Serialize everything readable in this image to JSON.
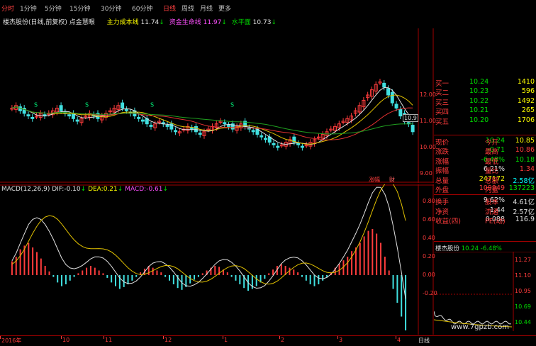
{
  "toolbar": {
    "tabs": [
      "分时",
      "1分钟",
      "5分钟",
      "15分钟",
      "30分钟",
      "60分钟",
      "日线",
      "周线",
      "月线",
      "更多"
    ],
    "active_tab": "日线"
  },
  "chart_header": {
    "stock_desc": "楼杰股份(日线,前复权) 点金慧眼",
    "ind1_label": "主力成本线",
    "ind1_value": "11.74",
    "ind2_label": "资金生命线",
    "ind2_value": "11.97",
    "ind3_label": "水平面",
    "ind3_value": "10.73"
  },
  "price_axis": [
    "12.00",
    "11.00",
    "10.00",
    "9.00"
  ],
  "price_tag": "10.9",
  "markers": {
    "m1": "涨幅",
    "m2": "财"
  },
  "macd_header": {
    "label": "MACD(12,26,9)",
    "dif_label": "DIF:",
    "dif_value": "-0.10",
    "dea_label": "DEA:",
    "dea_value": "0.21",
    "macd_label": "MACD:",
    "macd_value": "-0.61"
  },
  "macd_axis": [
    "0.80",
    "0.60",
    "0.40",
    "0.20",
    "0.00",
    "-0.20"
  ],
  "quote": {
    "bids": [
      {
        "label": "买一",
        "price": "10.24",
        "vol": "1410"
      },
      {
        "label": "买二",
        "price": "10.23",
        "vol": "596"
      },
      {
        "label": "买三",
        "price": "10.22",
        "vol": "1492"
      },
      {
        "label": "买四",
        "price": "10.21",
        "vol": "265"
      },
      {
        "label": "买五",
        "price": "10.20",
        "vol": "1706"
      }
    ],
    "stats": [
      {
        "l1": "现价",
        "v1": "10.24",
        "l2": "今开",
        "v2": "10.85"
      },
      {
        "l1": "涨跌",
        "v1": "-0.71",
        "l2": "最高",
        "v2": "10.86"
      },
      {
        "l1": "涨幅",
        "v1": "-6.48%",
        "l2": "最低",
        "v2": "10.18"
      },
      {
        "l1": "振幅",
        "v1": "6.21%",
        "l2": "量比",
        "v2": "1.34"
      },
      {
        "l1": "总量",
        "v1": "247172",
        "l2": "总额",
        "v2": "2.58亿"
      },
      {
        "l1": "外盘",
        "v1": "109949",
        "l2": "内盘",
        "v2": "137223"
      },
      {
        "l1": "换手",
        "v1": "9.62%",
        "l2": "股本",
        "v2": "4.61亿"
      },
      {
        "l1": "净资",
        "v1": "1.44",
        "l2": "流通",
        "v2": "2.57亿"
      },
      {
        "l1": "收益(四)",
        "v1": "0.088",
        "l2": "PE(动)",
        "v2": "116.9"
      }
    ]
  },
  "mini_chart": {
    "name": "楼杰股份",
    "price": "10.24",
    "change": "-6.48%",
    "axis": [
      "11.27",
      "11.10",
      "10.95",
      "10.69",
      "10.44"
    ]
  },
  "bottom_axis": {
    "labels": [
      "2016年",
      "10",
      "11",
      "12",
      "1",
      "2",
      "3",
      "4"
    ],
    "period": "日线",
    "watermark": "www.7gpzb.com"
  },
  "colors": {
    "up": "#ff3c3c",
    "down": "#40e0e0",
    "ma_white": "#e0e0e0",
    "ma_yellow": "#e0c000",
    "ma_red": "#e03030",
    "ma_green": "#20a020",
    "grid_red": "#a00000"
  }
}
